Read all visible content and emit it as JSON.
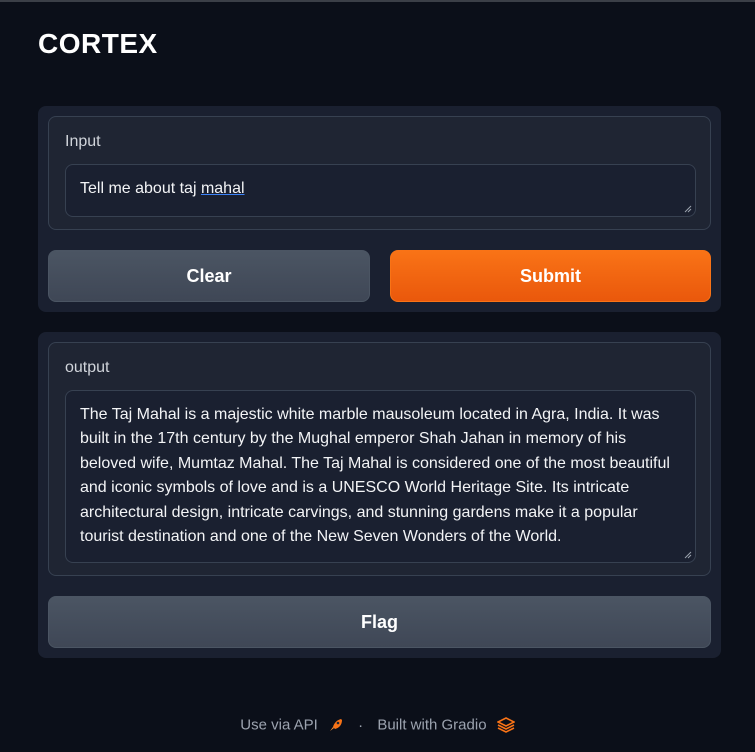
{
  "app": {
    "title": "CORTEX"
  },
  "input": {
    "label": "Input",
    "value_plain": "Tell me about taj ",
    "value_flagged": "mahal",
    "clear_label": "Clear",
    "submit_label": "Submit"
  },
  "output": {
    "label": "output",
    "value": "The Taj Mahal is a majestic white marble mausoleum located in Agra, India. It was built in the 17th century by the Mughal emperor Shah Jahan in memory of his beloved wife, Mumtaz Mahal. The Taj Mahal is considered one of the most beautiful and iconic symbols of love and is a UNESCO World Heritage Site. Its intricate architectural design, intricate carvings, and stunning gardens make it a popular tourist destination and one of the New Seven Wonders of the World.",
    "flag_label": "Flag"
  },
  "footer": {
    "api_link": "Use via API",
    "separator": "·",
    "built_with": "Built with Gradio"
  },
  "colors": {
    "background": "#0b0f19",
    "panel": "#1a2030",
    "primary": "#f97316",
    "secondary": "#4b5563"
  },
  "icons": [
    "rocket-icon",
    "gradio-logo-icon",
    "resize-handle-icon"
  ]
}
